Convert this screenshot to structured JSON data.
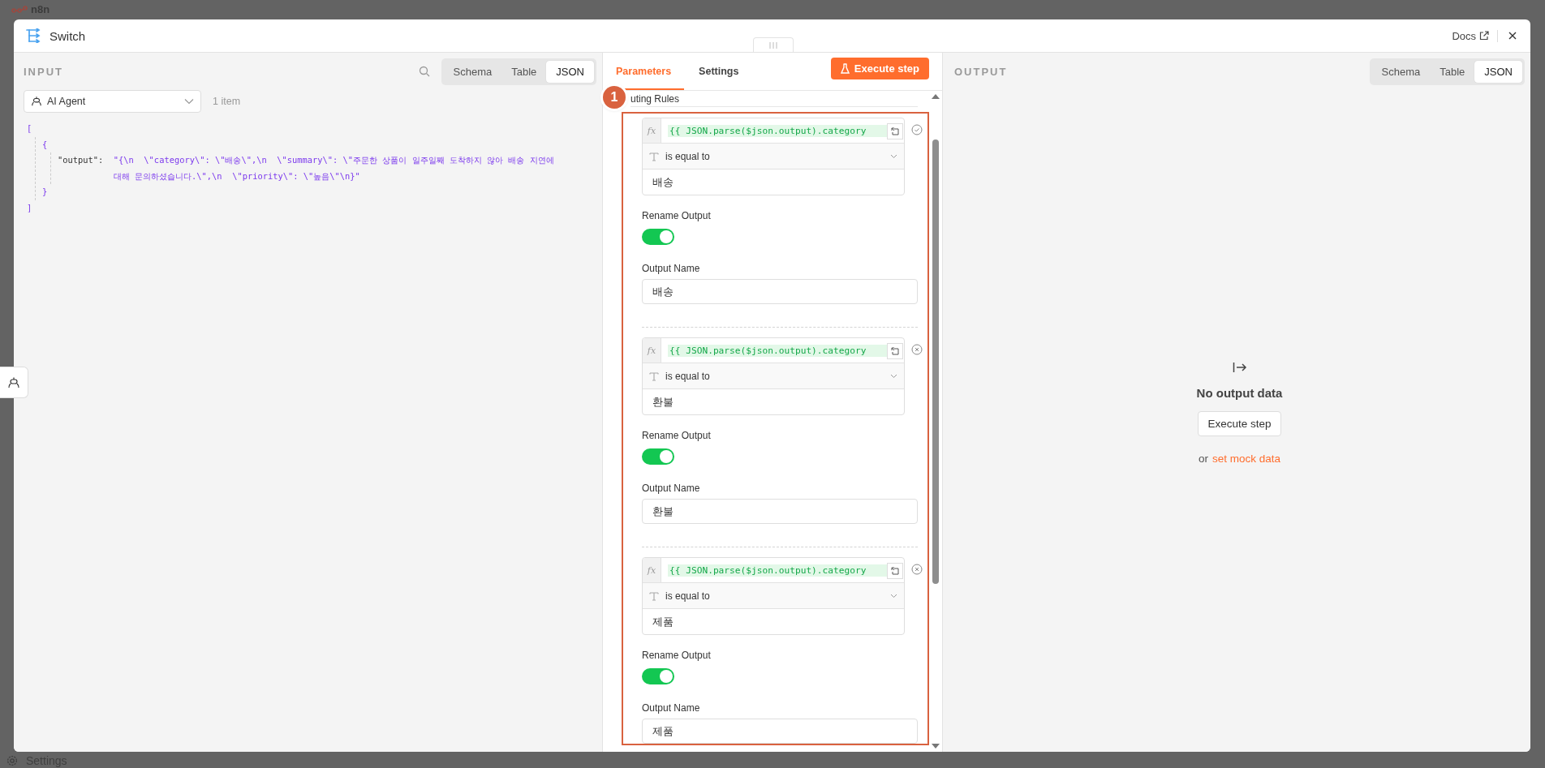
{
  "background_app": {
    "logo": "n8n",
    "settings_label": "Settings"
  },
  "modal": {
    "title": "Switch",
    "docs_link": "Docs"
  },
  "input_panel": {
    "label": "INPUT",
    "view_tabs": [
      {
        "label": "Schema",
        "selected": false
      },
      {
        "label": "Table",
        "selected": false
      },
      {
        "label": "JSON",
        "selected": true
      }
    ],
    "source": "AI Agent",
    "item_count": "1 item",
    "json": {
      "open": "[",
      "object_open": "{",
      "key": "\"output\":",
      "value_lines": [
        "\"{\\n  \\\"category\\\": \\\"배송\\\",\\n  \\\"summary\\\": \\\"주문한 상품이 일주일째 도착하지 않아 배송 지연에",
        "대해 문의하셨습니다.\\\",\\n  \\\"priority\\\": \\\"높음\\\"\\n}\""
      ],
      "object_close": "}",
      "close": "]"
    }
  },
  "parameters_panel": {
    "tabs": [
      {
        "label": "Parameters",
        "selected": true
      },
      {
        "label": "Settings",
        "selected": false
      }
    ],
    "execute_button": "Execute step",
    "step_badge": "1",
    "section_label": "uting Rules",
    "rules": [
      {
        "mode_label": "fx",
        "expression": "{{ JSON.parse($json.output).category",
        "operator": "is equal to",
        "value": "배송",
        "confirmed": true,
        "rename_output_label": "Rename Output",
        "rename_output": true,
        "output_name_label": "Output Name",
        "output_name": "배송"
      },
      {
        "mode_label": "fx",
        "expression": "{{ JSON.parse($json.output).category",
        "operator": "is equal to",
        "value": "환불",
        "confirmed": false,
        "rename_output_label": "Rename Output",
        "rename_output": true,
        "output_name_label": "Output Name",
        "output_name": "환불"
      },
      {
        "mode_label": "fx",
        "expression": "{{ JSON.parse($json.output).category",
        "operator": "is equal to",
        "value": "제품",
        "confirmed": false,
        "rename_output_label": "Rename Output",
        "rename_output": true,
        "output_name_label": "Output Name",
        "output_name": "제품"
      }
    ]
  },
  "output_panel": {
    "label": "OUTPUT",
    "view_tabs": [
      {
        "label": "Schema",
        "selected": false
      },
      {
        "label": "Table",
        "selected": false
      },
      {
        "label": "JSON",
        "selected": true
      }
    ],
    "empty_title": "No output data",
    "execute_button": "Execute step",
    "mock_prefix": "or",
    "mock_link": "set mock data"
  }
}
